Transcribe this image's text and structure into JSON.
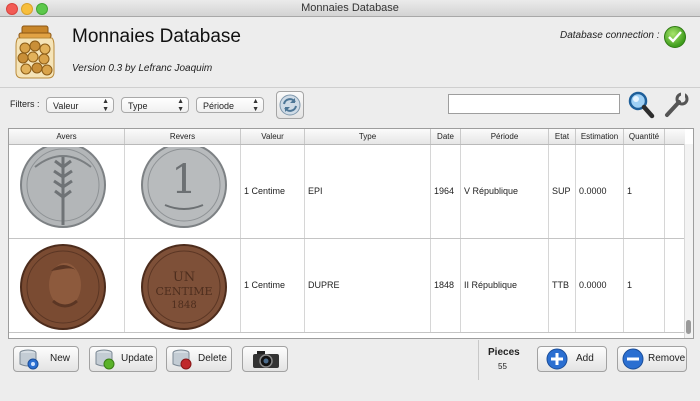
{
  "window": {
    "title": "Monnaies Database"
  },
  "header": {
    "app_title": "Monnaies Database",
    "version": "Version 0.3 by Lefranc Joaquim",
    "db_connection_label": "Database connection :",
    "db_status_icon": "check-icon"
  },
  "filters": {
    "label": "Filters :",
    "selects": [
      {
        "label": "Valeur"
      },
      {
        "label": "Type"
      },
      {
        "label": "Période"
      }
    ]
  },
  "search": {
    "value": "",
    "placeholder": ""
  },
  "table": {
    "columns": [
      "Avers",
      "Revers",
      "Valeur",
      "Type",
      "Date",
      "Période",
      "Etat",
      "Estimation",
      "Quantité"
    ],
    "rows": [
      {
        "avers": "coin-epi-obverse",
        "revers": "coin-epi-reverse",
        "valeur": "1 Centime",
        "type": "EPI",
        "date": "1964",
        "periode": "V République",
        "etat": "SUP",
        "estimation": "0.0000",
        "quantite": "1"
      },
      {
        "avers": "coin-dupre-obverse",
        "revers": "coin-dupre-reverse",
        "valeur": "1 Centime",
        "type": "DUPRE",
        "date": "1848",
        "periode": "II République",
        "etat": "TTB",
        "estimation": "0.0000",
        "quantite": "1"
      }
    ]
  },
  "actions": {
    "new": "New",
    "update": "Update",
    "delete": "Delete",
    "add": "Add",
    "remove": "Remove"
  },
  "pieces": {
    "label": "Pieces",
    "count": "55"
  },
  "colors": {
    "accent_blue": "#2b6fd1",
    "ok_green": "#3f9d1c",
    "delete_red": "#c0282a"
  }
}
